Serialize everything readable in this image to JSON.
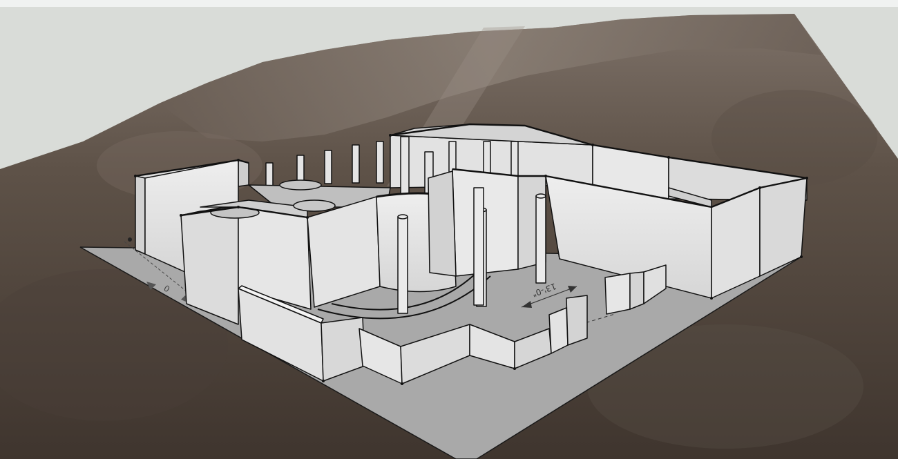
{
  "app": {
    "view": "3d-model-viewport"
  },
  "colors": {
    "sky": "#d9dcd8",
    "terrain_dark": "#4a4038",
    "terrain_mid": "#6b5f55",
    "terrain_light": "#8c8178",
    "ground_plate": "#a9a9a9",
    "wall_face": "#e6e6e6",
    "wall_shade": "#cfcfcf",
    "edge": "#111111"
  },
  "dimensions": {
    "label_front": "13'-0\"",
    "label_side": "0"
  }
}
